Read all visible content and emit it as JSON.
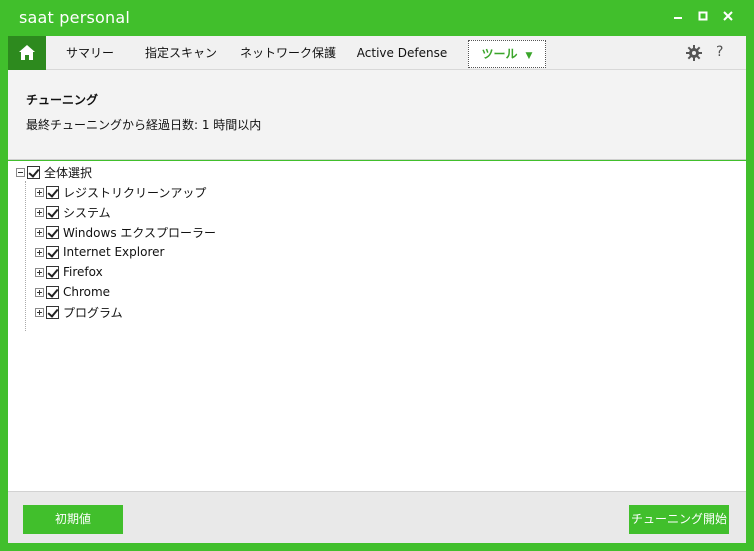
{
  "app": {
    "title": "saat personal",
    "minimize": "▬",
    "maximize": "□",
    "close": "✕"
  },
  "nav": {
    "tabs": [
      {
        "label": "サマリー"
      },
      {
        "label": "指定スキャン"
      },
      {
        "label": "ネットワーク保護"
      },
      {
        "label": "Active Defense"
      },
      {
        "label": "ツール"
      }
    ],
    "help": "?",
    "icons": {
      "home": "home-icon",
      "settings": "gear-icon",
      "dropdown": "chevron-down-icon"
    },
    "accent": "#41bf2c"
  },
  "info": {
    "title": "チューニング",
    "status": "最終チューニングから経過日数: 1 時間以内"
  },
  "tree": {
    "root": {
      "label": "全体選択",
      "checked": true,
      "expanded": true
    },
    "items": [
      {
        "label": "レジストリクリーンアップ",
        "checked": true
      },
      {
        "label": "システム",
        "checked": true
      },
      {
        "label": "Windows エクスプローラー",
        "checked": true
      },
      {
        "label": "Internet Explorer",
        "checked": true
      },
      {
        "label": "Firefox",
        "checked": true
      },
      {
        "label": "Chrome",
        "checked": true
      },
      {
        "label": "プログラム",
        "checked": true
      }
    ]
  },
  "footer": {
    "default_label": "初期値",
    "start_label": "チューニング開始"
  }
}
